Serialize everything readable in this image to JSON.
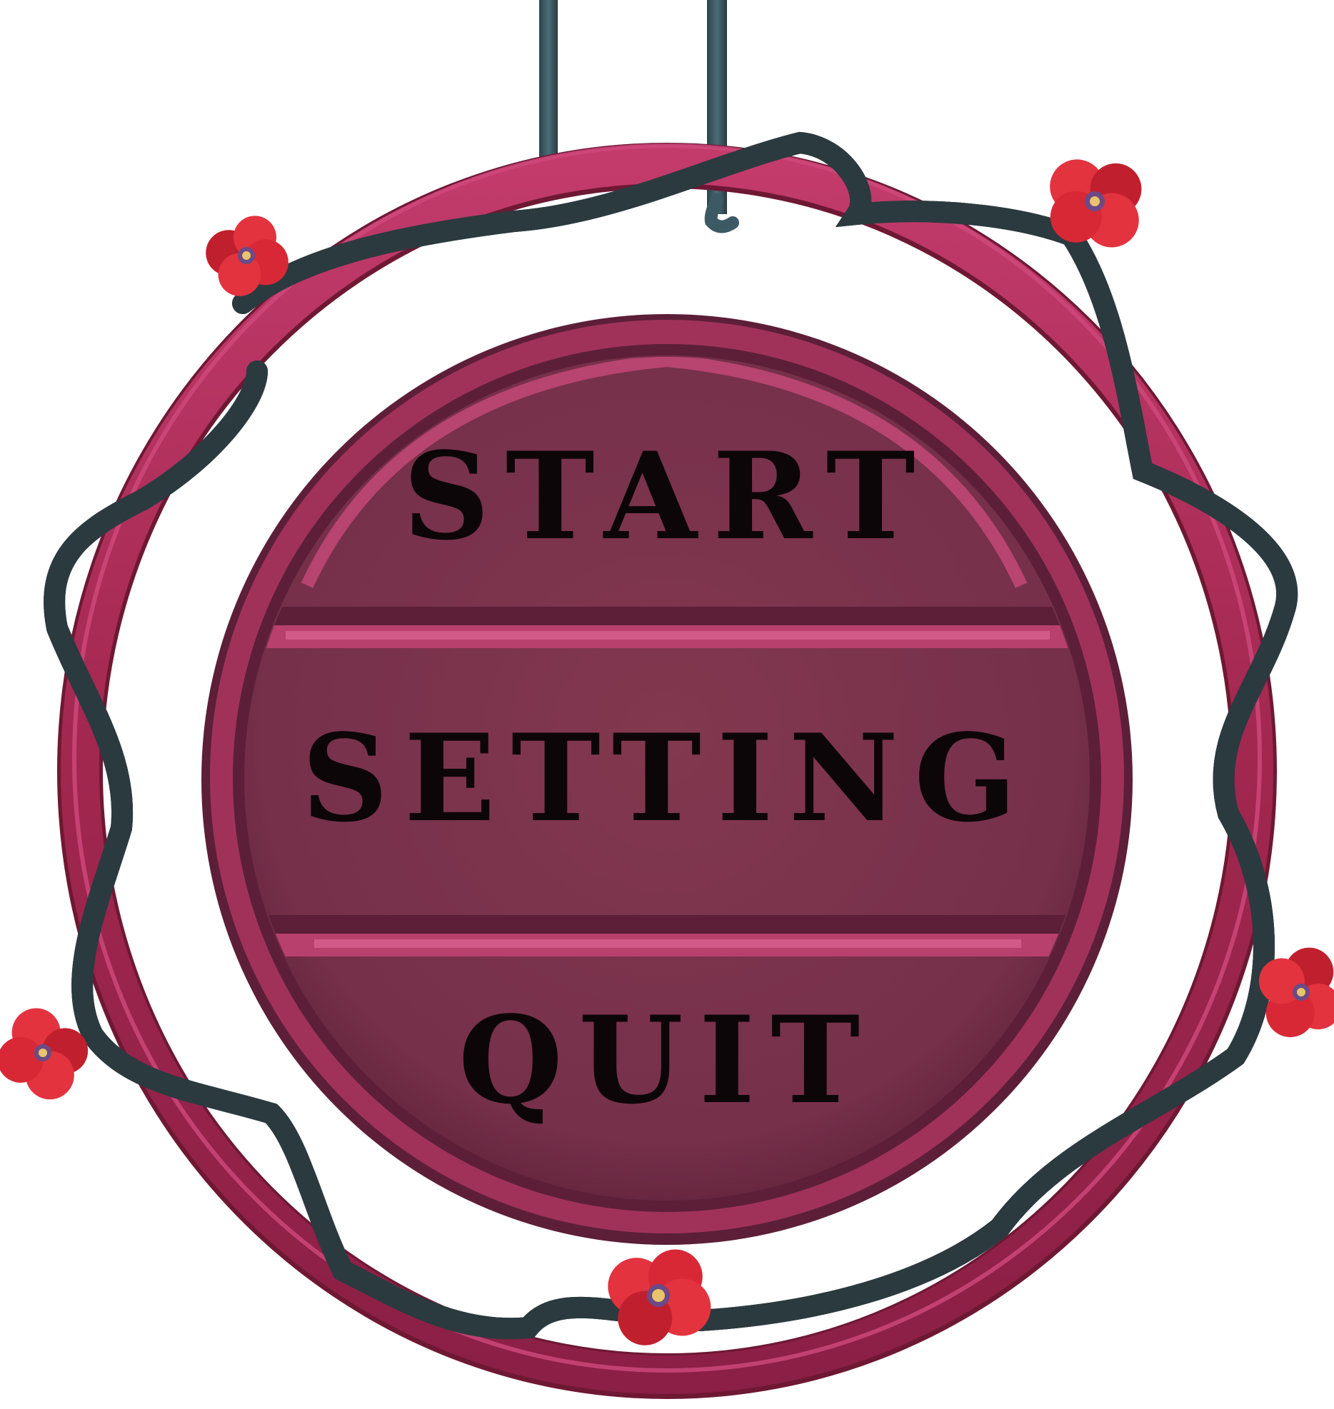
{
  "menu": {
    "items": [
      {
        "id": "start",
        "label": "START"
      },
      {
        "id": "setting",
        "label": "SETTING"
      },
      {
        "id": "quit",
        "label": "QUIT"
      }
    ]
  },
  "colors": {
    "ring": "#a1274f",
    "ring_highlight": "#cf4a7c",
    "ring_shadow": "#6e1834",
    "plate": "#7a344c",
    "plate_edge": "#5c1f37",
    "plate_rim": "#a0325a",
    "divider": "#c84a79",
    "vine": "#3c5a63",
    "vine_dark": "#2c3b40",
    "flower": "#e2333f",
    "flower_dark": "#c0202e",
    "flower_center": "#6b4a86",
    "flower_pollen": "#e9c46a",
    "label": "#0d0608",
    "background": "#ffffff"
  },
  "icons": {
    "flower": "poppy-flower-icon",
    "vine": "thorn-vine"
  }
}
